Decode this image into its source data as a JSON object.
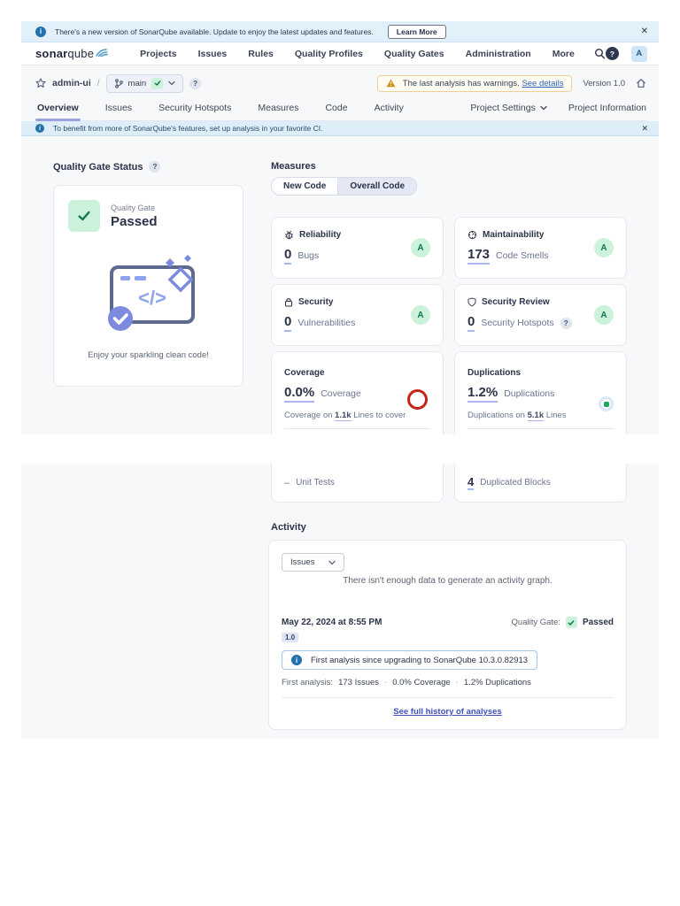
{
  "update_banner": {
    "text": "There's a new version of SonarQube available. Update to enjoy the latest updates and features.",
    "learn_more_label": "Learn More",
    "close": "✕"
  },
  "nav": {
    "logo_bold": "sonar",
    "logo_light": "qube",
    "items": [
      "Projects",
      "Issues",
      "Rules",
      "Quality Profiles",
      "Quality Gates",
      "Administration",
      "More"
    ],
    "help_label": "?",
    "avatar_label": "A"
  },
  "project_header": {
    "project_name": "admin-ui",
    "separator": "/",
    "branch_name": "main",
    "branch_help": "?",
    "warning_text": "The last analysis has warnings.",
    "warning_link": "See details",
    "version_label": "Version 1.0"
  },
  "project_nav": {
    "tabs": [
      "Overview",
      "Issues",
      "Security Hotspots",
      "Measures",
      "Code",
      "Activity"
    ],
    "settings_label": "Project Settings",
    "info_label": "Project Information"
  },
  "ci_banner": {
    "text": "To benefit from more of SonarQube's features, set up analysis in your favorite CI.",
    "close": "✕"
  },
  "quality_gate": {
    "section_title": "Quality Gate Status",
    "help": "?",
    "card_label": "Quality Gate",
    "status": "Passed",
    "caption": "Enjoy your sparkling clean code!"
  },
  "measures": {
    "section_title": "Measures",
    "toggle": [
      "New Code",
      "Overall Code"
    ],
    "cards": [
      {
        "title": "Reliability",
        "value": "0",
        "label": "Bugs",
        "rating": "A"
      },
      {
        "title": "Maintainability",
        "value": "173",
        "label": "Code Smells",
        "rating": "A"
      },
      {
        "title": "Security",
        "value": "0",
        "label": "Vulnerabilities",
        "rating": "A"
      },
      {
        "title": "Security Review",
        "value": "0",
        "label": "Security Hotspots",
        "rating": "A",
        "help": "?"
      },
      {
        "title": "Coverage",
        "value": "0.0%",
        "label": "Coverage",
        "footnote_pre": "Coverage on",
        "footnote_link": "1.1k",
        "footnote_post": "Lines to cover"
      },
      {
        "title": "Duplications",
        "value": "1.2%",
        "label": "Duplications",
        "footnote_pre": "Duplications on",
        "footnote_link": "5.1k",
        "footnote_post": "Lines"
      }
    ],
    "partial_metrics": {
      "unit_tests_value": "–",
      "unit_tests_label": "Unit Tests",
      "duplicated_blocks_value": "4",
      "duplicated_blocks_label": "Duplicated Blocks"
    }
  },
  "activity": {
    "section_title": "Activity",
    "graph_select_value": "Issues",
    "empty_graph_text": "There isn't enough data to generate an activity graph.",
    "analysis_date": "May 22, 2024 at 8:55 PM",
    "quality_gate_label": "Quality Gate:",
    "quality_gate_status": "Passed",
    "version_badge": "1.0",
    "first_analysis_note": "First analysis since upgrading to SonarQube 10.3.0.82913",
    "summary_label": "First analysis:",
    "summary_issues": "173 Issues",
    "summary_coverage": "0.0% Coverage",
    "summary_duplications": "1.2% Duplications",
    "separator": "·",
    "history_link": "See full history of analyses"
  },
  "colors": {
    "banner_blue_bg": "#e2f0f9",
    "page_gray_bg": "#f7f8fa",
    "link_blue": "#2d63b8",
    "rating_green_bg": "#cdf2dc",
    "rating_green_text": "#0c7a4a",
    "accent_indigo": "#8d9fe8",
    "warning_orange": "#cf8d12",
    "annotation_red": "#c42318"
  }
}
